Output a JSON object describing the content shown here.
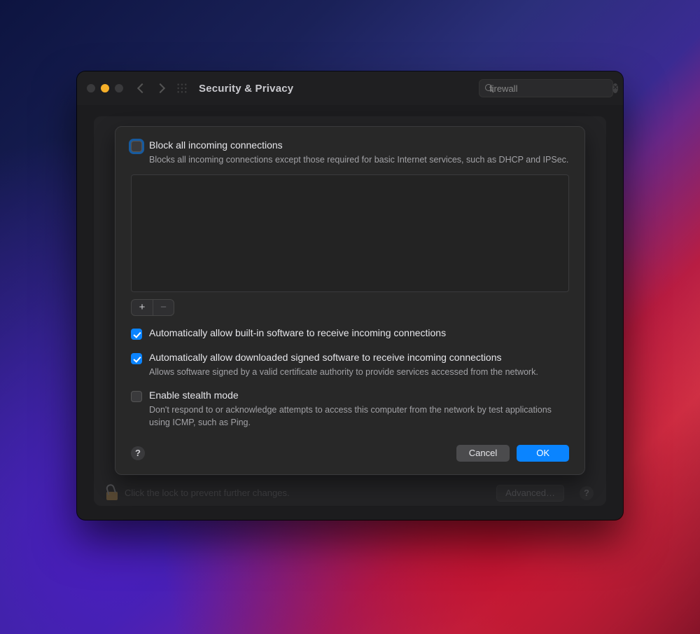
{
  "window": {
    "title": "Security & Privacy",
    "search_value": "firewall"
  },
  "sheet": {
    "block_all": {
      "label": "Block all incoming connections",
      "desc": "Blocks all incoming connections except those required for basic Internet services, such as DHCP and IPSec.",
      "checked": false
    },
    "auto_builtin": {
      "label": "Automatically allow built-in software to receive incoming connections",
      "checked": true
    },
    "auto_signed": {
      "label": "Automatically allow downloaded signed software to receive incoming connections",
      "desc": "Allows software signed by a valid certificate authority to provide services accessed from the network.",
      "checked": true
    },
    "stealth": {
      "label": "Enable stealth mode",
      "desc": "Don't respond to or acknowledge attempts to access this computer from the network by test applications using ICMP, such as Ping.",
      "checked": false
    },
    "buttons": {
      "cancel": "Cancel",
      "ok": "OK"
    }
  },
  "bottom": {
    "lock_text": "Click the lock to prevent further changes.",
    "advanced": "Advanced…"
  }
}
